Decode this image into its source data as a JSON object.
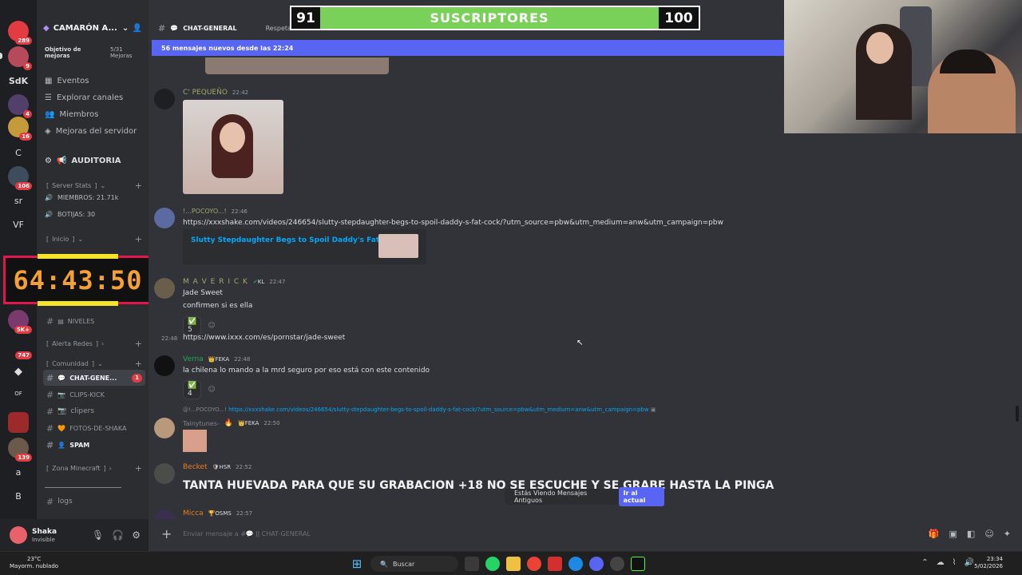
{
  "server": {
    "name": "CAMARÓN A...",
    "boost_goal": "Objetivo de mejoras",
    "boost_count": "5/31 Mejoras",
    "nav": [
      "Eventos",
      "Explorar canales",
      "Miembros",
      "Mejoras del servidor"
    ],
    "auditoria": "AUDITORIA",
    "categories": {
      "server_stats": "Server Stats",
      "inicio": "Inicio",
      "alerta": "Alerta Redes",
      "comunidad": "Comunidad",
      "minecraft": "Zona Minecraft"
    },
    "stats": {
      "miembros": "MIEMBROS: 21.71k",
      "bots": "BOTIJAS: 30"
    },
    "channels": [
      {
        "name": "NIVELES"
      },
      {
        "name": "CHAT-GENE...",
        "unread": "1"
      },
      {
        "name": "CLIPS-KICK"
      },
      {
        "name": "clipers"
      },
      {
        "name": "FOTOS-DE-SHAKA"
      },
      {
        "name": "SPAM"
      },
      {
        "name": "logs"
      }
    ]
  },
  "rail": [
    {
      "label": "",
      "badge": "289"
    },
    {
      "label": "",
      "badge": "9"
    },
    {
      "label": "SdK",
      "badge": ""
    },
    {
      "label": "",
      "badge": "4"
    },
    {
      "label": "",
      "badge": "16"
    },
    {
      "label": "C",
      "badge": ""
    },
    {
      "label": "",
      "badge": "106"
    },
    {
      "label": "sr",
      "badge": ""
    },
    {
      "label": "VF",
      "badge": ""
    },
    {
      "label": "",
      "badge": "5K+"
    },
    {
      "label": "",
      "badge": "747"
    },
    {
      "label": "",
      "badge": ""
    },
    {
      "label": "OF",
      "badge": ""
    },
    {
      "label": "",
      "badge": ""
    },
    {
      "label": "",
      "badge": "139"
    },
    {
      "label": "a",
      "badge": ""
    },
    {
      "label": "B",
      "badge": ""
    }
  ],
  "user": {
    "name": "Shaka",
    "status": "Invisible"
  },
  "timer": "64:43:50",
  "header": {
    "channel": "CHAT-GENERAL",
    "topic": "Respetar las n"
  },
  "new_messages_bar": "56 mensajes nuevos desde las 22:24",
  "messages": [
    {
      "author": "C' PEQUEÑO",
      "time": "22:42",
      "color": "#a2a86b"
    },
    {
      "author": "!...POCOYO...!",
      "time": "22:46",
      "link": "https://xxxshake.com/videos/246654/slutty-stepdaughter-begs-to-spoil-daddy-s-fat-cock/?utm_source=pbw&utm_medium=anw&utm_campaign=pbw",
      "embed_title": "Slutty Stepdaughter Begs to Spoil Daddy's Fat Cock",
      "color": "#a2a86b"
    },
    {
      "author": "M A V E R I C K",
      "tag": "KL",
      "time": "22:47",
      "lines": [
        "Jade Sweet",
        "confirmen si es ella"
      ],
      "reaction_count": "5",
      "color": "#a2a86b"
    },
    {
      "time": "22:48",
      "link": "https://www.ixxx.com/es/pornstar/jade-sweet"
    },
    {
      "author": "Verna",
      "tag": "FEKA",
      "time": "22:48",
      "text": "la chilena lo mando a la mrd seguro por eso está con este contenido",
      "reaction_count": "4",
      "color": "#23a559"
    },
    {
      "reply_author": "@!...POCOYO...!",
      "reply_link": "https://xxxshake.com/videos/246654/slutty-stepdaughter-begs-to-spoil-daddy-s-fat-cock/?utm_source=pbw&utm_medium=anw&utm_campaign=pbw",
      "author": "Tainytunes-",
      "tag": "FEKA",
      "time": "22:50",
      "color": "#80848e"
    },
    {
      "author": "Becket",
      "tag": "HSR",
      "time": "22:52",
      "text": "TANTA HUEVADA PARA QUE SU GRABACION +18 NO SE ESCUCHE Y SE GRABE HASTA LA PINGA",
      "color": "#e67e22"
    },
    {
      "author": "Micca",
      "tag": "OSMS",
      "time": "22:57",
      "color": "#e67e22"
    }
  ],
  "toast": {
    "text": "Estás Viendo Mensajes Antiguos",
    "button": "Ir al actual"
  },
  "composer": {
    "placeholder": "Enviar mensaje a #💬 ǀǀ CHAT-GENERAL"
  },
  "overlay": {
    "left": "91",
    "label": "SUSCRIPTORES",
    "right": "100",
    "accent": "#7ad15a"
  },
  "taskbar": {
    "weather_temp": "23°C",
    "weather_desc": "Mayorm. nublado",
    "search": "Buscar",
    "time": "23:34",
    "date": "5/02/2026"
  }
}
